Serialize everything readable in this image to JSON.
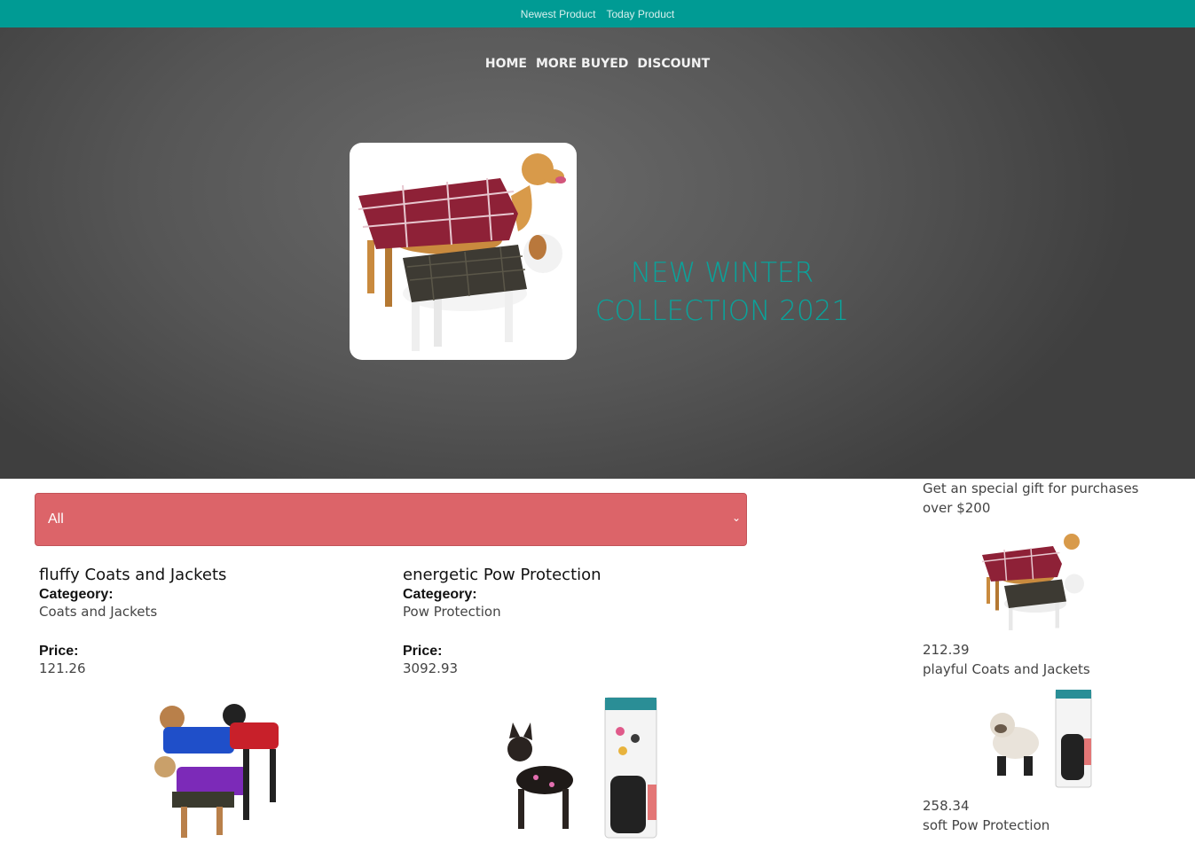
{
  "topbar": {
    "links": [
      "Newest Product",
      "Today Product"
    ]
  },
  "nav": {
    "items": [
      "HOME",
      "MORE BUYED",
      "DISCOUNT"
    ]
  },
  "hero": {
    "title_line1": "NEW WINTER",
    "title_line2": "COLLECTION 2021",
    "accent_color": "#0aa39b"
  },
  "filter": {
    "selected": "All",
    "color": "#dc6469"
  },
  "products": [
    {
      "title": "fluffy Coats and Jackets",
      "category_label": "Categeory:",
      "category": "Coats and Jackets",
      "price_label": "Price:",
      "price": "121.26"
    },
    {
      "title": "energetic Pow Protection",
      "category_label": "Categeory:",
      "category": "Pow Protection",
      "price_label": "Price:",
      "price": "3092.93"
    }
  ],
  "sidebar": {
    "promo": "Get an special gift for purchases over $200",
    "items": [
      {
        "price": "212.39",
        "name": "playful Coats and Jackets"
      },
      {
        "price": "258.34",
        "name": "soft Pow Protection"
      }
    ]
  },
  "brand_color": "#009b94"
}
